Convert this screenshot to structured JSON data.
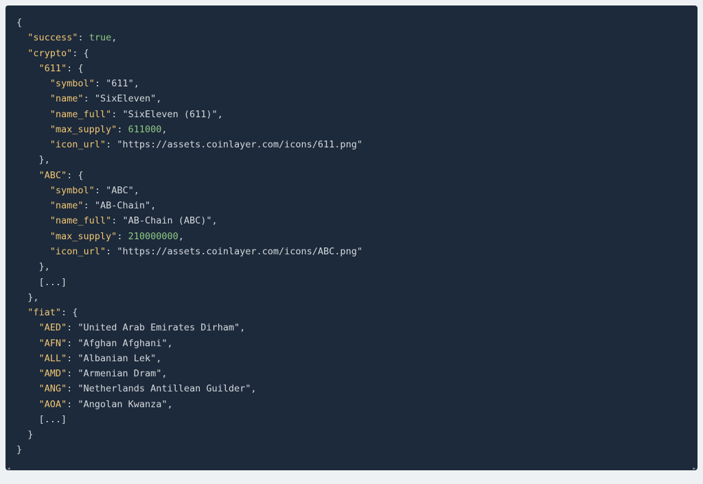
{
  "code": {
    "open_brace": "{",
    "close_brace": "}",
    "indent1": "  ",
    "indent2": "    ",
    "indent3": "      ",
    "indent4": "        ",
    "lines": {
      "success_key": "\"success\"",
      "success_val": "true",
      "crypto_key": "\"crypto\"",
      "crypto_611_key": "\"611\"",
      "symbol_key": "\"symbol\"",
      "name_key": "\"name\"",
      "name_full_key": "\"name_full\"",
      "max_supply_key": "\"max_supply\"",
      "icon_url_key": "\"icon_url\"",
      "c611_symbol_val": "\"611\"",
      "c611_name_val": "\"SixEleven\"",
      "c611_name_full_val": "\"SixEleven (611)\"",
      "c611_max_supply_val": "611000",
      "c611_icon_url_val": "\"https://assets.coinlayer.com/icons/611.png\"",
      "crypto_abc_key": "\"ABC\"",
      "abc_symbol_val": "\"ABC\"",
      "abc_name_val": "\"AB-Chain\"",
      "abc_name_full_val": "\"AB-Chain (ABC)\"",
      "abc_max_supply_val": "210000000",
      "abc_icon_url_val": "\"https://assets.coinlayer.com/icons/ABC.png\"",
      "ellipsis": "[...]",
      "fiat_key": "\"fiat\"",
      "fiat_aed_key": "\"AED\"",
      "fiat_aed_val": "\"United Arab Emirates Dirham\"",
      "fiat_afn_key": "\"AFN\"",
      "fiat_afn_val": "\"Afghan Afghani\"",
      "fiat_all_key": "\"ALL\"",
      "fiat_all_val": "\"Albanian Lek\"",
      "fiat_amd_key": "\"AMD\"",
      "fiat_amd_val": "\"Armenian Dram\"",
      "fiat_ang_key": "\"ANG\"",
      "fiat_ang_val": "\"Netherlands Antillean Guilder\"",
      "fiat_aoa_key": "\"AOA\"",
      "fiat_aoa_val": "\"Angolan Kwanza\""
    }
  },
  "scrollbar": {
    "left": "◂",
    "right": "▸"
  }
}
